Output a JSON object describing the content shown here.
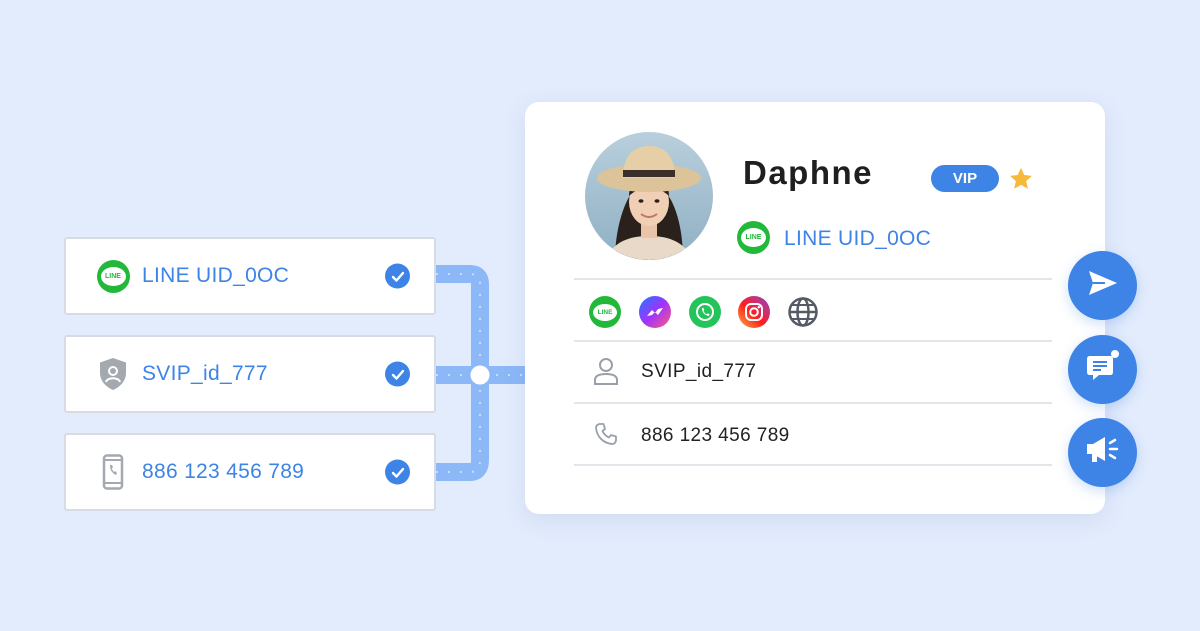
{
  "identities": [
    {
      "icon": "line-icon",
      "label": "LINE UID_0OC",
      "badge_text": "LINE"
    },
    {
      "icon": "shield-user-icon",
      "label": "SVIP_id_777"
    },
    {
      "icon": "mobile-phone-icon",
      "label": "886 123 456 789"
    }
  ],
  "profile": {
    "name": "Daphne",
    "vip_label": "VIP",
    "line_uid": "LINE UID_0OC",
    "line_badge_text": "LINE",
    "channels": [
      "line-icon",
      "messenger-icon",
      "whatsapp-icon",
      "instagram-icon",
      "globe-icon"
    ],
    "member_id": "SVIP_id_777",
    "phone": "886 123 456 789"
  },
  "actions": [
    "send-icon",
    "chat-message-icon",
    "megaphone-icon"
  ],
  "colors": {
    "accent": "#3d84e6",
    "line_green": "#22b93b",
    "star": "#f6b93b",
    "background": "#e3ecfd"
  }
}
